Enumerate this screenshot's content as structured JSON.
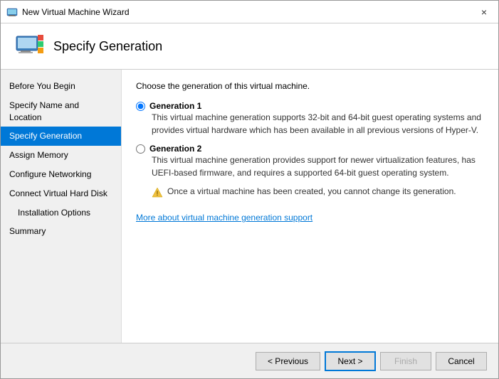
{
  "window": {
    "title": "New Virtual Machine Wizard",
    "close_label": "×"
  },
  "header": {
    "title": "Specify Generation"
  },
  "sidebar": {
    "items": [
      {
        "id": "before-you-begin",
        "label": "Before You Begin",
        "active": false,
        "sub": false
      },
      {
        "id": "specify-name-location",
        "label": "Specify Name and Location",
        "active": false,
        "sub": false
      },
      {
        "id": "specify-generation",
        "label": "Specify Generation",
        "active": true,
        "sub": false
      },
      {
        "id": "assign-memory",
        "label": "Assign Memory",
        "active": false,
        "sub": false
      },
      {
        "id": "configure-networking",
        "label": "Configure Networking",
        "active": false,
        "sub": false
      },
      {
        "id": "connect-virtual-hard-disk",
        "label": "Connect Virtual Hard Disk",
        "active": false,
        "sub": false
      },
      {
        "id": "installation-options",
        "label": "Installation Options",
        "active": false,
        "sub": true
      },
      {
        "id": "summary",
        "label": "Summary",
        "active": false,
        "sub": false
      }
    ]
  },
  "content": {
    "description": "Choose the generation of this virtual machine.",
    "generation1": {
      "label": "Generation 1",
      "description": "This virtual machine generation supports 32-bit and 64-bit guest operating systems and provides virtual hardware which has been available in all previous versions of Hyper-V."
    },
    "generation2": {
      "label": "Generation 2",
      "description": "This virtual machine generation provides support for newer virtualization features, has UEFI-based firmware, and requires a supported 64-bit guest operating system."
    },
    "warning": "Once a virtual machine has been created, you cannot change its generation.",
    "link": "More about virtual machine generation support"
  },
  "footer": {
    "previous_label": "< Previous",
    "next_label": "Next >",
    "finish_label": "Finish",
    "cancel_label": "Cancel"
  }
}
